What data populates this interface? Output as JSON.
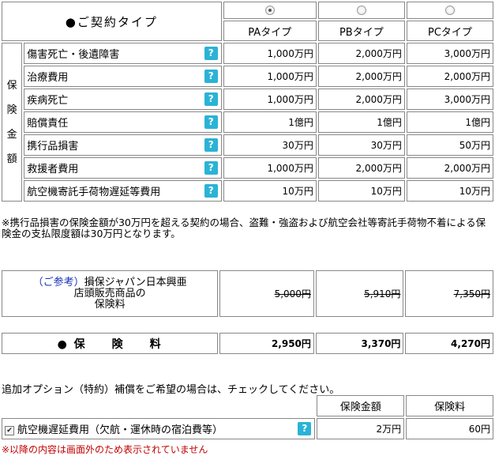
{
  "contract_type_label": "●ご契約タイプ",
  "plans": [
    {
      "name": "PAタイプ",
      "selected": true
    },
    {
      "name": "PBタイプ",
      "selected": false
    },
    {
      "name": "PCタイプ",
      "selected": false
    }
  ],
  "coverage_side_label": [
    "保",
    "険",
    "金",
    "額"
  ],
  "help_icon_glyph": "?",
  "coverage_rows": [
    {
      "label": "傷害死亡・後遺障害",
      "values": [
        "1,000万円",
        "2,000万円",
        "3,000万円"
      ]
    },
    {
      "label": "治療費用",
      "values": [
        "1,000万円",
        "2,000万円",
        "2,000万円"
      ]
    },
    {
      "label": "疾病死亡",
      "values": [
        "1,000万円",
        "2,000万円",
        "3,000万円"
      ]
    },
    {
      "label": "賠償責任",
      "values": [
        "1億円",
        "1億円",
        "1億円"
      ]
    },
    {
      "label": "携行品損害",
      "values": [
        "30万円",
        "30万円",
        "50万円"
      ]
    },
    {
      "label": "救援者費用",
      "values": [
        "1,000万円",
        "2,000万円",
        "2,000万円"
      ]
    },
    {
      "label": "航空機寄託手荷物遅延等費用",
      "values": [
        "10万円",
        "10万円",
        "10万円"
      ]
    }
  ],
  "note": "※携行品損害の保険金額が30万円を超える契約の場合、盗難・強盗および航空会社等寄託手荷物不着による保険金の支払限度額は30万円となります。",
  "reference": {
    "prefix": "（ご参考）",
    "label_line1": "損保ジャパン日本興亜",
    "label_line2": "店頭販売商品の",
    "label_line3": "保険料",
    "values": [
      "5,000円",
      "5,910円",
      "7,350円"
    ]
  },
  "premium": {
    "label": "● 保　　険　　料",
    "values": [
      "2,950円",
      "3,370円",
      "4,270円"
    ]
  },
  "option": {
    "title": "追加オプション（特約）補償をご希望の場合は、チェックしてください。",
    "col_amount": "保険金額",
    "col_premium": "保険料",
    "label": "航空機遅延費用（欠航・運休時の宿泊費等）",
    "checked": true,
    "amount": "2万円",
    "premium": "60円"
  },
  "cut_text": "※以降の内容は画面外のため表示されていません"
}
